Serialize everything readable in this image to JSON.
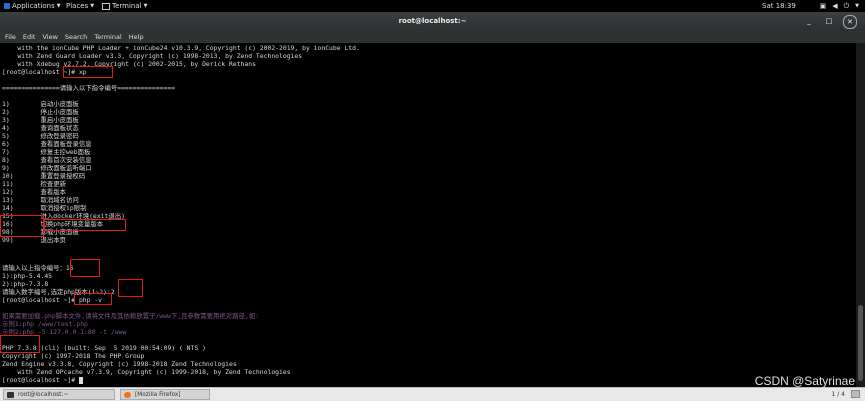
{
  "topbar": {
    "applications": "Applications",
    "places": "Places",
    "app": "Terminal",
    "clock": "Sat 18:39",
    "icons": [
      "network-icon",
      "volume-icon",
      "power-icon"
    ]
  },
  "window": {
    "title": "root@localhost:~"
  },
  "menu": [
    "File",
    "Edit",
    "View",
    "Search",
    "Terminal",
    "Help"
  ],
  "terminal": {
    "lines": [
      "    with the ionCube PHP Loader + ionCube24 v10.3.9, Copyright (c) 2002-2019, by ionCube Ltd.",
      "    with Zend Guard Loader v3.3, Copyright (c) 1998-2013, by Zend Technologies",
      "    with Xdebug v2.7.2, Copyright (c) 2002-2015, by Derick Rethans",
      "[root@localhost ~]# xp",
      "",
      "===============请输入以下指令编号===============",
      "",
      "1)        启动小皮面板",
      "2)        停止小皮面板",
      "3)        重启小皮面板",
      "4)        查询面板状态",
      "5)        修改登录密码",
      "6)        查看面板登录信息",
      "7)        修复主控web面板",
      "8)        查看首次安装信息",
      "9)        修改面板监听端口",
      "10)       重置登录授权码",
      "11)       检查更新",
      "12)       查看版本",
      "13)       取消域名访问",
      "14)       取消授权ip限制",
      "15)       进入docker环境(exit退出)",
      "16)       切换php环境变量版本",
      "98)       卸载小皮面板",
      "99)       退出本页",
      "",
      "",
      "请输入以上指令编号：16",
      "1):php-5.4.45",
      "2):php-7.3.8",
      "请输入数字编号,选定php版本(1~2):2",
      "[root@localhost ~]# php -v",
      "",
      "如果需要加载.php脚本文件,请将文件及其依赖放置于/www下,且参数需要用绝对路径,如:",
      "示例1:php /www/test.php",
      "示例2:php -S 127.0.0.1:80 -t /www",
      "",
      "PHP 7.3.8 (cli) (built: Sep  5 2019 00:54:09) ( NTS )",
      "Copyright (c) 1997-2018 The PHP Group",
      "Zend Engine v3.3.8, Copyright (c) 1998-2018 Zend Technologies",
      "    with Zend OPcache v7.3.9, Copyright (c) 1999-2018, by Zend Technologies",
      "[root@localhost ~]# "
    ]
  },
  "taskbar": {
    "items": [
      "root@localhost:~",
      "[Mozilla Firefox]"
    ],
    "pager": "1 / 4"
  },
  "watermark": "CSDN @Satyrinae",
  "colors": {
    "highlight": "#e21b1b",
    "hint_text": "#7a5a8c"
  }
}
